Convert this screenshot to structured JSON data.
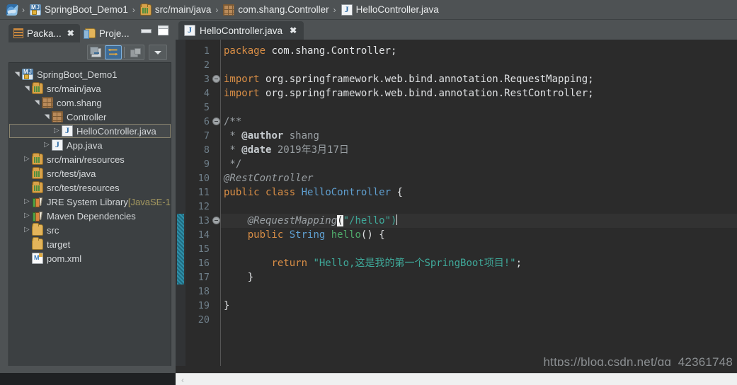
{
  "breadcrumb": {
    "items": [
      {
        "label": "",
        "icon": "navigate-icon"
      },
      {
        "label": "SpringBoot_Demo1",
        "icon": "project-icon"
      },
      {
        "label": "src/main/java",
        "icon": "source-folder-icon"
      },
      {
        "label": "com.shang.Controller",
        "icon": "package-icon"
      },
      {
        "label": "HelloController.java",
        "icon": "java-file-icon"
      }
    ],
    "separator": "›"
  },
  "left_panel": {
    "tabs": [
      {
        "label": "Packa...",
        "icon": "package-explorer-icon",
        "active": true,
        "close": "✖"
      },
      {
        "label": "Proje...",
        "icon": "project-explorer-icon",
        "active": false
      }
    ],
    "window_buttons": [
      {
        "name": "minimize",
        "label": "—"
      },
      {
        "name": "maximize",
        "label": "□"
      }
    ],
    "toolbar": [
      {
        "name": "collapse-all-icon",
        "active": false
      },
      {
        "name": "link-with-editor-icon",
        "active": true
      },
      {
        "name": "view-filter-icon",
        "active": false
      },
      {
        "name": "view-menu-icon",
        "active": false
      }
    ],
    "tree": [
      {
        "label": "SpringBoot_Demo1",
        "icon": "project-icon",
        "indent": 0,
        "arrow": "open",
        "selected": false
      },
      {
        "label": "src/main/java",
        "icon": "source-folder-icon",
        "indent": 1,
        "arrow": "open",
        "selected": false
      },
      {
        "label": "com.shang",
        "icon": "package-icon",
        "indent": 2,
        "arrow": "open",
        "selected": false
      },
      {
        "label": "Controller",
        "icon": "package-icon",
        "indent": 3,
        "arrow": "open",
        "selected": false
      },
      {
        "label": "HelloController.java",
        "icon": "java-file-icon",
        "indent": 4,
        "arrow": "closed",
        "selected": true
      },
      {
        "label": "App.java",
        "icon": "java-file-icon",
        "indent": 3,
        "arrow": "closed",
        "selected": false
      },
      {
        "label": "src/main/resources",
        "icon": "source-folder-icon",
        "indent": 1,
        "arrow": "closed",
        "selected": false
      },
      {
        "label": "src/test/java",
        "icon": "source-folder-icon",
        "indent": 1,
        "arrow": "none",
        "selected": false
      },
      {
        "label": "src/test/resources",
        "icon": "source-folder-icon",
        "indent": 1,
        "arrow": "none",
        "selected": false
      },
      {
        "label": "JRE System Library",
        "suffix": "[JavaSE-1",
        "icon": "library-icon",
        "indent": 1,
        "arrow": "closed",
        "selected": false
      },
      {
        "label": "Maven Dependencies",
        "icon": "library-icon",
        "indent": 1,
        "arrow": "closed",
        "selected": false
      },
      {
        "label": "src",
        "icon": "folder-icon",
        "indent": 1,
        "arrow": "closed",
        "selected": false
      },
      {
        "label": "target",
        "icon": "folder-icon",
        "indent": 1,
        "arrow": "none",
        "selected": false
      },
      {
        "label": "pom.xml",
        "icon": "maven-xml-icon",
        "indent": 1,
        "arrow": "none",
        "selected": false
      }
    ]
  },
  "editor": {
    "tab": {
      "label": "HelloController.java",
      "icon": "java-file-icon",
      "close": "✖"
    },
    "current_line": 13,
    "change_bar_lines": [
      13,
      17
    ],
    "fold_lines": [
      3,
      6,
      13
    ],
    "line_numbers": [
      1,
      2,
      3,
      4,
      5,
      6,
      7,
      8,
      9,
      10,
      11,
      12,
      13,
      14,
      15,
      16,
      17,
      18,
      19,
      20
    ],
    "lines": [
      {
        "n": 1,
        "text": "package com.shang.Controller;"
      },
      {
        "n": 2,
        "text": ""
      },
      {
        "n": 3,
        "text": "import org.springframework.web.bind.annotation.RequestMapping;"
      },
      {
        "n": 4,
        "text": "import org.springframework.web.bind.annotation.RestController;"
      },
      {
        "n": 5,
        "text": ""
      },
      {
        "n": 6,
        "text": "/**"
      },
      {
        "n": 7,
        "text": " * @author shang"
      },
      {
        "n": 8,
        "text": " * @date 2019年3月17日"
      },
      {
        "n": 9,
        "text": " */"
      },
      {
        "n": 10,
        "text": "@RestController"
      },
      {
        "n": 11,
        "text": "public class HelloController {"
      },
      {
        "n": 12,
        "text": ""
      },
      {
        "n": 13,
        "text": "    @RequestMapping(\"/hello\")"
      },
      {
        "n": 14,
        "text": "    public String hello() {"
      },
      {
        "n": 15,
        "text": ""
      },
      {
        "n": 16,
        "text": "        return \"Hello,这是我的第一个SpringBoot项目!\";"
      },
      {
        "n": 17,
        "text": "    }"
      },
      {
        "n": 18,
        "text": ""
      },
      {
        "n": 19,
        "text": "}"
      },
      {
        "n": 20,
        "text": ""
      }
    ],
    "tokens": {
      "l1": [
        [
          "package",
          "kw"
        ],
        [
          " com.shang.Controller;",
          "plain"
        ]
      ],
      "l3": [
        [
          "import",
          "kw"
        ],
        [
          " org.springframework.web.bind.annotation.RequestMapping;",
          "plain"
        ]
      ],
      "l4": [
        [
          "import",
          "kw"
        ],
        [
          " org.springframework.web.bind.annotation.RestController;",
          "plain"
        ]
      ],
      "l6": [
        [
          "/**",
          "cmt"
        ]
      ],
      "l7": [
        [
          " * ",
          "cmt"
        ],
        [
          "@author",
          "cmtb"
        ],
        [
          " shang",
          "cmt"
        ]
      ],
      "l8": [
        [
          " * ",
          "cmt"
        ],
        [
          "@date",
          "cmtb"
        ],
        [
          " 2019年3月17日",
          "cmt"
        ]
      ],
      "l9": [
        [
          " */",
          "cmt"
        ]
      ],
      "l10": [
        [
          "@RestController",
          "anno"
        ]
      ],
      "l11": [
        [
          "public",
          "kw"
        ],
        [
          " ",
          "plain"
        ],
        [
          "class",
          "kw"
        ],
        [
          " ",
          "plain"
        ],
        [
          "HelloController",
          "type"
        ],
        [
          " {",
          "plain"
        ]
      ],
      "l13": [
        [
          "    ",
          "plain"
        ],
        [
          "@RequestMapping",
          "anno"
        ],
        [
          "(",
          "hl"
        ],
        [
          "\"/hello\"",
          "str"
        ],
        [
          ")",
          "str"
        ]
      ],
      "l14": [
        [
          "    ",
          "plain"
        ],
        [
          "public",
          "kw"
        ],
        [
          " ",
          "plain"
        ],
        [
          "String",
          "type"
        ],
        [
          " ",
          "plain"
        ],
        [
          "hello",
          "meth"
        ],
        [
          "() {",
          "plain"
        ]
      ],
      "l16": [
        [
          "        ",
          "plain"
        ],
        [
          "return",
          "kw"
        ],
        [
          " ",
          "plain"
        ],
        [
          "\"Hello,这是我的第一个SpringBoot项目!\"",
          "str"
        ],
        [
          ";",
          "plain"
        ]
      ],
      "l17": [
        [
          "    }",
          "plain"
        ]
      ],
      "l19": [
        [
          "}",
          "plain"
        ]
      ]
    },
    "watermark": "https://blog.csdn.net/qq_42361748"
  },
  "scrollbar": {
    "left_arrow": "‹"
  },
  "colors": {
    "editor_bg": "#2b2b2b",
    "chrome_bg": "#4e5254",
    "panel_bg": "#3c4042",
    "keyword": "#d98e46",
    "string": "#3fa99a",
    "type": "#5f9fd0",
    "method": "#4fa96a",
    "comment": "#9aa0a4",
    "line_number": "#6f7f8a",
    "accent_blue": "#3f6c96",
    "change_bar": "#2f8fa8"
  }
}
